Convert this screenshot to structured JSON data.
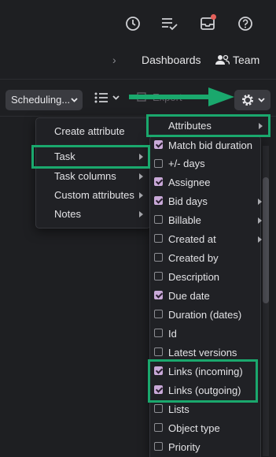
{
  "topbar": {
    "icons": [
      "clock-icon",
      "checklist-icon",
      "inbox-icon",
      "help-icon"
    ],
    "nav": {
      "dashboards": "Dashboards",
      "team": "Team"
    }
  },
  "toolbar": {
    "scheduling": "Scheduling...",
    "export": "Export"
  },
  "menu1": {
    "items": [
      {
        "label": "Create attribute",
        "submenu": false
      },
      {
        "label": "Task",
        "submenu": true
      },
      {
        "label": "Task columns",
        "submenu": true
      },
      {
        "label": "Custom attributes",
        "submenu": true
      },
      {
        "label": "Notes",
        "submenu": true
      }
    ]
  },
  "menu2": {
    "header": "Attributes",
    "items": [
      {
        "label": "Match bid duration",
        "checked": true,
        "submenu": false
      },
      {
        "label": "+/- days",
        "checked": false,
        "submenu": false
      },
      {
        "label": "Assignee",
        "checked": true,
        "submenu": false
      },
      {
        "label": "Bid days",
        "checked": true,
        "submenu": true
      },
      {
        "label": "Billable",
        "checked": false,
        "submenu": true
      },
      {
        "label": "Created at",
        "checked": false,
        "submenu": true
      },
      {
        "label": "Created by",
        "checked": false,
        "submenu": false
      },
      {
        "label": "Description",
        "checked": false,
        "submenu": false
      },
      {
        "label": "Due date",
        "checked": true,
        "submenu": false
      },
      {
        "label": "Duration (dates)",
        "checked": false,
        "submenu": false
      },
      {
        "label": "Id",
        "checked": false,
        "submenu": false
      },
      {
        "label": "Latest versions",
        "checked": false,
        "submenu": false
      },
      {
        "label": "Links (incoming)",
        "checked": true,
        "submenu": false
      },
      {
        "label": "Links (outgoing)",
        "checked": true,
        "submenu": false
      },
      {
        "label": "Lists",
        "checked": false,
        "submenu": false
      },
      {
        "label": "Object type",
        "checked": false,
        "submenu": false
      },
      {
        "label": "Priority",
        "checked": false,
        "submenu": false
      }
    ]
  },
  "colors": {
    "highlight": "#1aa86d",
    "checkbox": "#c9a9d8",
    "notification": "#e5605a"
  }
}
